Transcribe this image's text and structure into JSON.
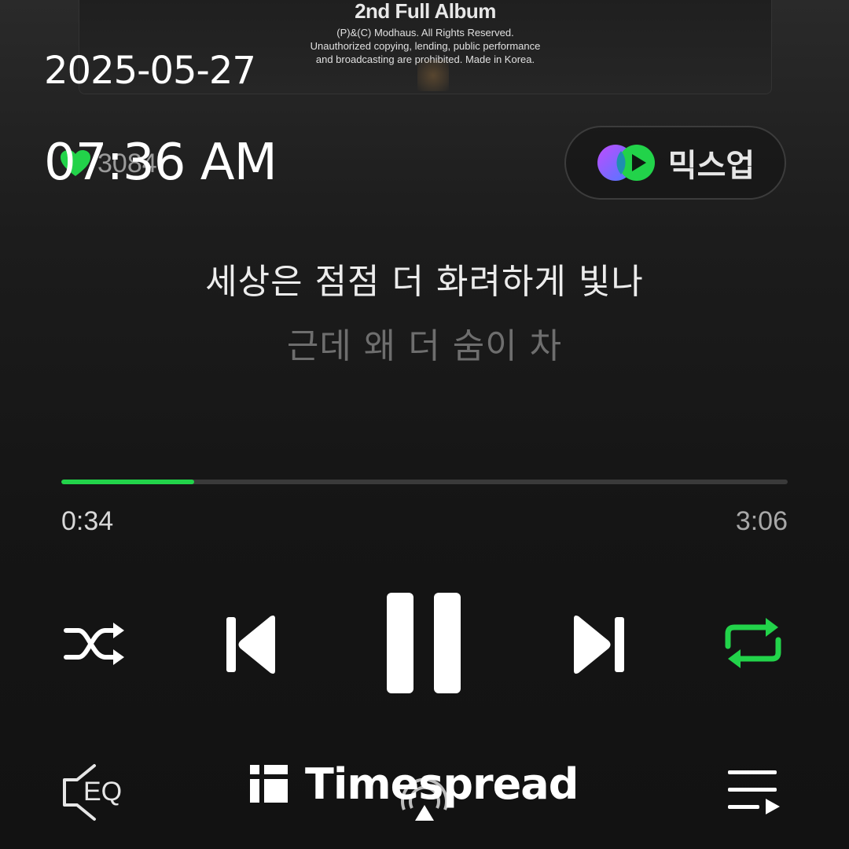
{
  "album": {
    "title": "2nd Full Album",
    "copyright_lines": [
      "(P)&(C) Modhaus. All Rights Reserved.",
      "Unauthorized copying, lending, public performance",
      "and broadcasting are prohibited. Made in Korea."
    ]
  },
  "overlay": {
    "date": "2025-05-27",
    "time": "07:36 AM"
  },
  "like": {
    "count": "3084",
    "icon": "heart-icon",
    "color": "#22d34a"
  },
  "mixup": {
    "label": "믹스업",
    "icon": "mixup-logo-icon"
  },
  "lyrics": {
    "current": "세상은 점점 더 화려하게 빛나",
    "next": "근데 왜 더 숨이 차"
  },
  "progress": {
    "elapsed": "0:34",
    "total": "3:06",
    "fraction": 0.183,
    "accent": "#22d34a"
  },
  "controls": {
    "shuffle": "shuffle-icon",
    "previous": "skip-previous-icon",
    "pause": "pause-icon",
    "next": "skip-next-icon",
    "repeat": "repeat-icon",
    "repeat_active": true
  },
  "bottom": {
    "eq_label": "EQ",
    "airplay": "airplay-icon",
    "playlist": "playlist-icon"
  },
  "watermark": {
    "text": "Timespread"
  }
}
